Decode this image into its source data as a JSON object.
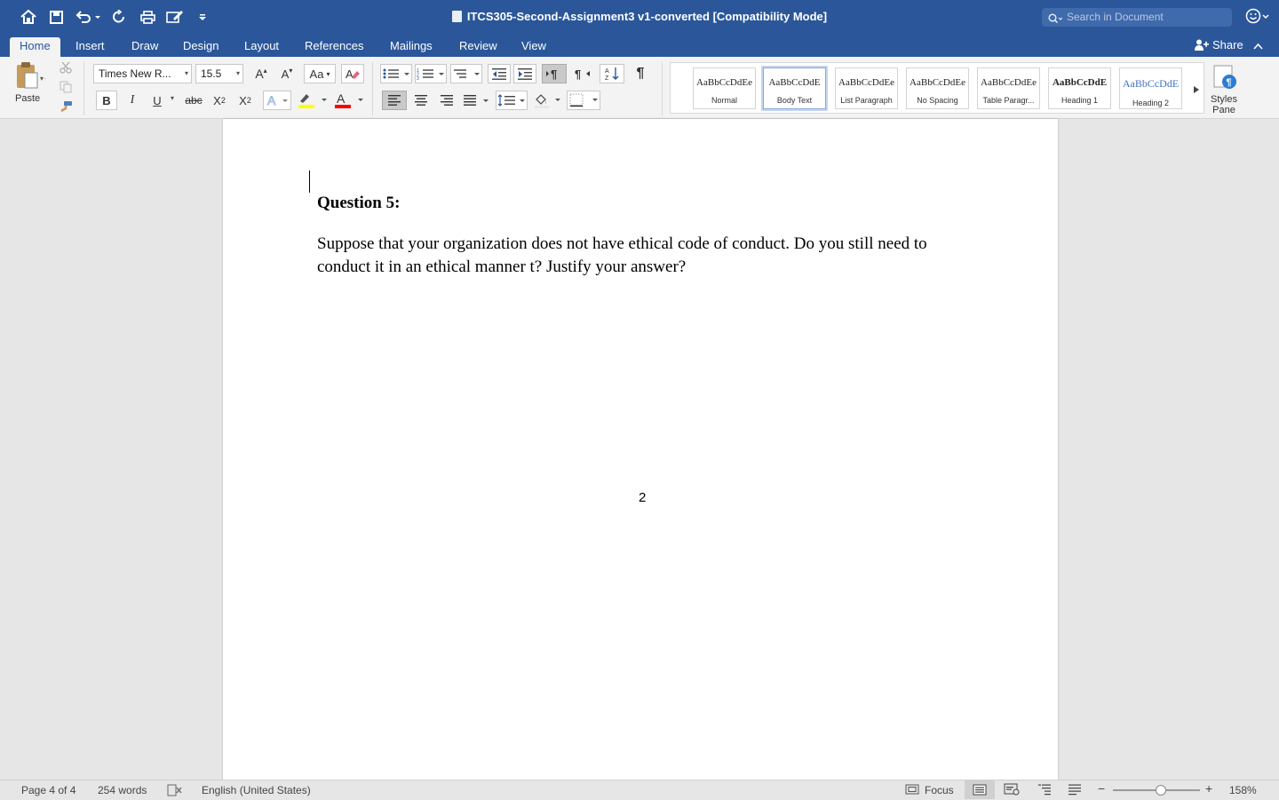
{
  "window": {
    "title": "ITCS305-Second-Assignment3 v1-converted [Compatibility Mode]",
    "search_placeholder": "Search in Document"
  },
  "quick_access": [
    "home-icon",
    "save-icon",
    "undo-icon",
    "redo-icon",
    "print-icon",
    "edit-icon",
    "customize-icon"
  ],
  "tabs": [
    {
      "label": "Home",
      "active": true
    },
    {
      "label": "Insert"
    },
    {
      "label": "Draw"
    },
    {
      "label": "Design"
    },
    {
      "label": "Layout"
    },
    {
      "label": "References"
    },
    {
      "label": "Mailings"
    },
    {
      "label": "Review"
    },
    {
      "label": "View"
    }
  ],
  "share_label": "Share",
  "ribbon": {
    "paste_label": "Paste",
    "font_name": "Times New R...",
    "font_size": "15.5",
    "bold": "B",
    "italic": "I",
    "underline": "U",
    "strikethrough": "abc",
    "subscript": "X",
    "subscript_mark": "2",
    "superscript": "X",
    "superscript_mark": "2",
    "pilcrow": "¶",
    "styles_pane_label": "Styles Pane",
    "highlight_color": "#ffff00",
    "font_color": "#ff0000",
    "styles": [
      {
        "preview": "AaBbCcDdEe",
        "name": "Normal"
      },
      {
        "preview": "AaBbCcDdE",
        "name": "Body Text",
        "selected": true
      },
      {
        "preview": "AaBbCcDdEe",
        "name": "List Paragraph"
      },
      {
        "preview": "AaBbCcDdEe",
        "name": "No Spacing"
      },
      {
        "preview": "AaBbCcDdEe",
        "name": "Table Paragr..."
      },
      {
        "preview": "AaBbCcDdE",
        "name": "Heading 1"
      },
      {
        "preview": "AaBbCcDdE",
        "name": "Heading 2"
      }
    ]
  },
  "document": {
    "heading": "Question 5:",
    "body": "Suppose that your organization does not have ethical code of conduct. Do you still need to conduct it in an ethical manner t? Justify your answer?",
    "page_number": "2"
  },
  "status": {
    "page": "Page 4 of 4",
    "words": "254 words",
    "language": "English (United States)",
    "focus": "Focus",
    "zoom": "158%",
    "zoom_minus": "−",
    "zoom_plus": "+"
  },
  "colors": {
    "brand": "#2b579a",
    "ribbon_bg": "#f3f3f3",
    "canvas_bg": "#e6e6e6"
  }
}
